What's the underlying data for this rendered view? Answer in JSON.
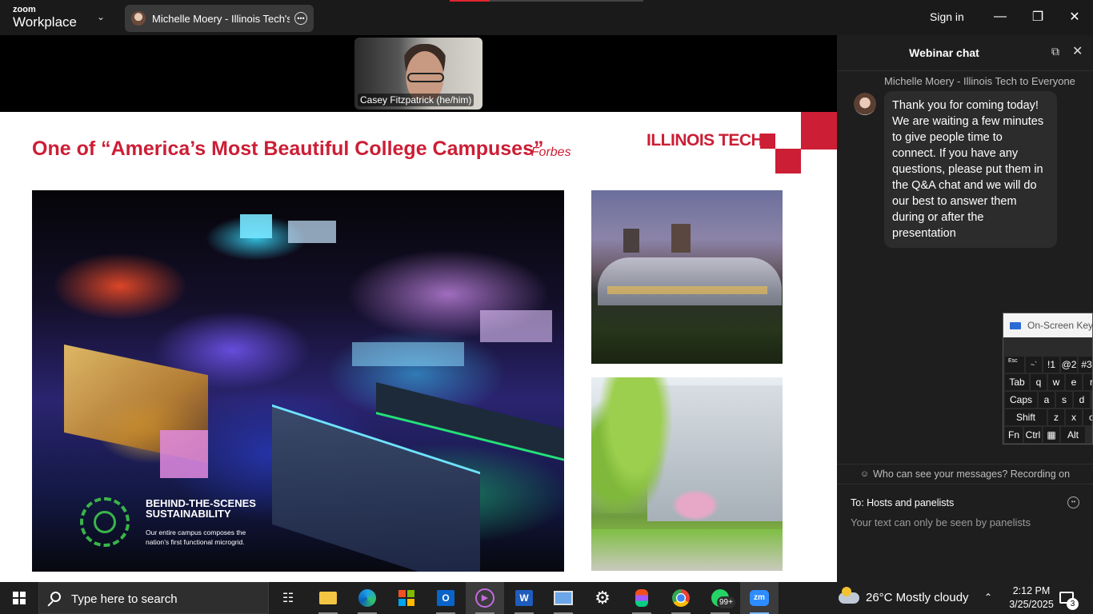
{
  "app": {
    "brand_small": "zoom",
    "brand_big": "Workplace",
    "meeting_tab_title": "Michelle Moery - Illinois Tech's sє",
    "sign_in": "Sign in"
  },
  "video": {
    "participant_name": "Casey Fitzpatrick (he/him)"
  },
  "slide": {
    "title": "One of “America’s Most Beautiful College Campuses”",
    "source": "- Forbes",
    "logo": "ILLINOIS TECH",
    "sustainability_heading": "BEHIND-THE-SCENES SUSTAINABILITY",
    "sustainability_text": "Our entire campus composes the nation’s first functional microgrid.",
    "colors": {
      "accent": "#cc1e35",
      "green": "#39b54a"
    }
  },
  "chat": {
    "title": "Webinar chat",
    "message_from": "Michelle Moery - Illinois Tech to Everyone",
    "message_text": "Thank you for coming today! We are waiting a few minutes to give people time to connect. If you have any questions, please put them in the Q&A chat and we will do our best to answer them during or after the presentation",
    "visibility_note": "Who can see your messages? Recording on",
    "to_label": "To:  Hosts and panelists",
    "input_placeholder": "Your text can only be seen by panelists"
  },
  "osk": {
    "title": "On-Screen Keyb",
    "row1": [
      "Esc",
      "~`",
      "!1",
      "@2",
      "#3"
    ],
    "row2": [
      "Tab",
      "q",
      "w",
      "e",
      "r"
    ],
    "row3": [
      "Caps",
      "a",
      "s",
      "d"
    ],
    "row4": [
      "Shift",
      "z",
      "x",
      "c"
    ],
    "row5": [
      "Fn",
      "Ctrl",
      "Alt"
    ]
  },
  "taskbar": {
    "search_placeholder": "Type here to search",
    "whatsapp_badge": "99+",
    "weather": "26°C  Mostly cloudy",
    "time": "2:12 PM",
    "date": "3/25/2025",
    "notifications": "3",
    "apps": [
      "task-view",
      "file-explorer",
      "edge",
      "microsoft-store",
      "outlook",
      "media-player",
      "word",
      "remote-desktop",
      "settings",
      "figma",
      "chrome",
      "whatsapp",
      "zoom"
    ]
  }
}
